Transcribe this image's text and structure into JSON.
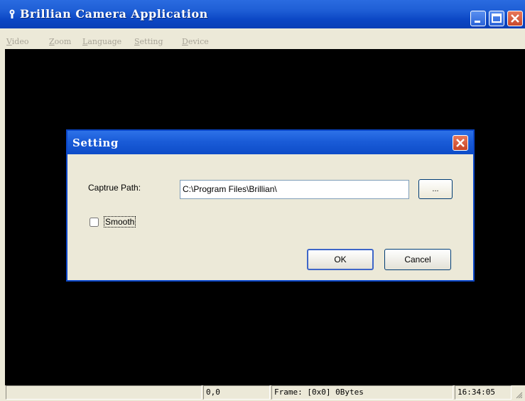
{
  "window": {
    "title": "Brillian Camera Application",
    "app_icon": "app-camera-icon"
  },
  "menubar": {
    "items": [
      {
        "first": "V",
        "rest": "ideo"
      },
      {
        "first": "Z",
        "rest": "oom"
      },
      {
        "first": "L",
        "rest": "anguage"
      },
      {
        "first": "S",
        "rest": "etting"
      },
      {
        "first": "D",
        "rest": "evice"
      }
    ]
  },
  "statusbar": {
    "pane1": "",
    "coords": "0,0",
    "frame": "Frame: [0x0] 0Bytes",
    "time": "16:34:05"
  },
  "dialog": {
    "title": "Setting",
    "capture_path_label": "Captrue Path:",
    "capture_path_value": "C:\\Program Files\\Brillian\\",
    "browse_label": "...",
    "smooth_label": "Smooth",
    "smooth_checked": false,
    "ok_label": "OK",
    "cancel_label": "Cancel"
  },
  "colors": {
    "titlebar": "#0a46c8",
    "video_background": "#000000",
    "window_face": "#ece9d8"
  }
}
